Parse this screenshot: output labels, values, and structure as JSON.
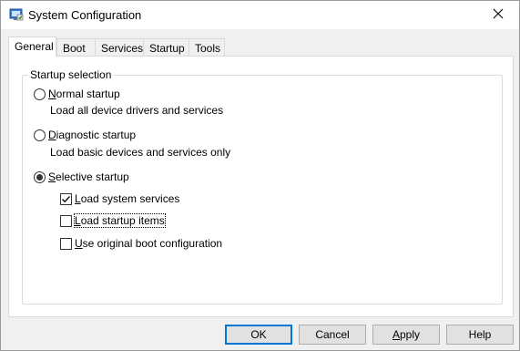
{
  "window": {
    "title": "System Configuration",
    "icon": "msconfig-app-icon",
    "close_icon": "close-icon"
  },
  "tabs": [
    {
      "label": "General",
      "active": true
    },
    {
      "label": "Boot",
      "active": false
    },
    {
      "label": "Services",
      "active": false
    },
    {
      "label": "Startup",
      "active": false
    },
    {
      "label": "Tools",
      "active": false
    }
  ],
  "general": {
    "group_label": "Startup selection",
    "options": [
      {
        "mnemonic": "N",
        "rest": "ormal startup",
        "description": "Load all device drivers and services",
        "selected": false
      },
      {
        "mnemonic": "D",
        "rest": "iagnostic startup",
        "description": "Load basic devices and services only",
        "selected": false
      },
      {
        "mnemonic": "S",
        "rest": "elective startup",
        "description": "",
        "selected": true
      }
    ],
    "checks": [
      {
        "mnemonic": "L",
        "rest": "oad system services",
        "checked": true,
        "focused": false
      },
      {
        "mnemonic": "L",
        "rest": "oad startup items",
        "checked": false,
        "focused": true
      },
      {
        "mnemonic": "U",
        "rest": "se original boot configuration",
        "checked": false,
        "focused": false
      }
    ]
  },
  "buttons": {
    "ok": "OK",
    "cancel": "Cancel",
    "apply_mnemonic": "A",
    "apply_rest": "pply",
    "help": "Help"
  },
  "colors": {
    "accent": "#0078d7",
    "window_bg": "#f0f0f0",
    "panel_bg": "#ffffff"
  }
}
